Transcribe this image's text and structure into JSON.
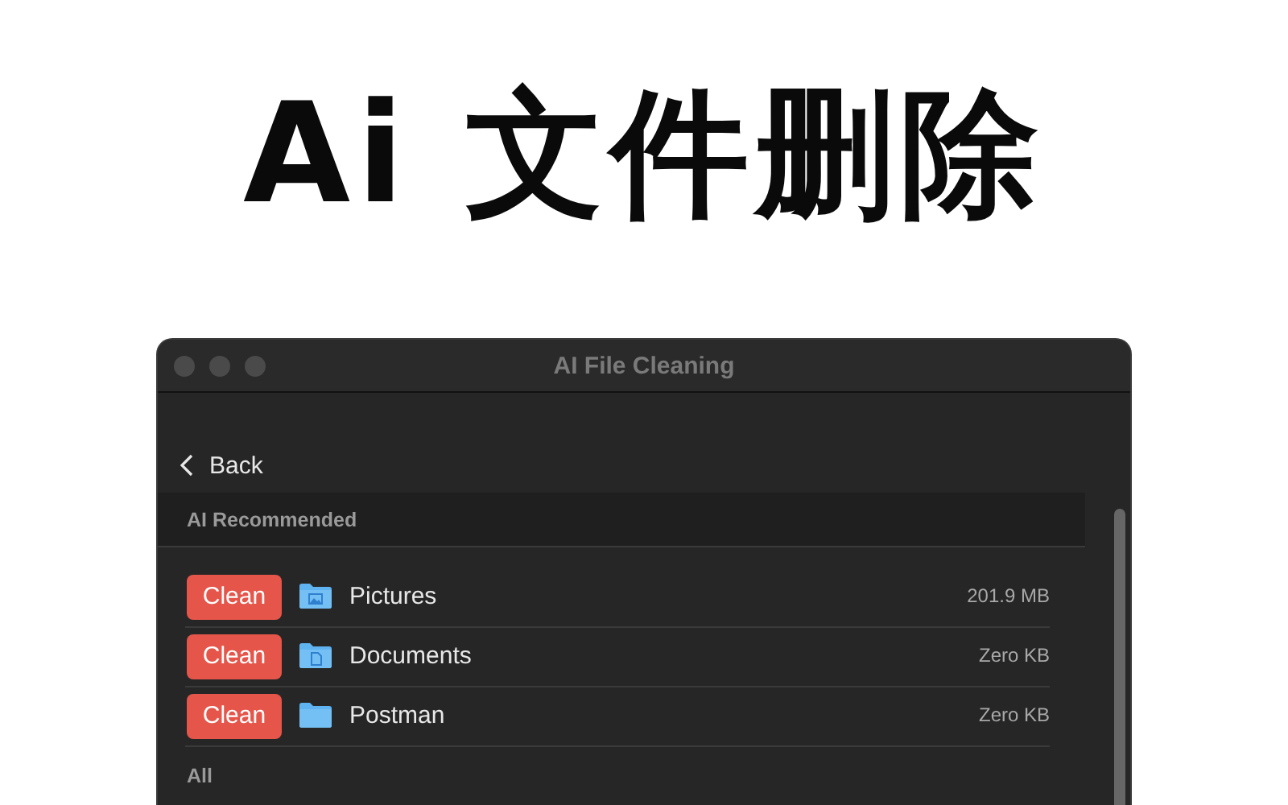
{
  "headline": "Ai 文件删除",
  "window": {
    "title": "AI File Cleaning"
  },
  "back": {
    "label": "Back"
  },
  "section": {
    "title": "AI Recommended"
  },
  "items": [
    {
      "action": "Clean",
      "kind": "pictures",
      "name": "Pictures",
      "size": "201.9 MB"
    },
    {
      "action": "Clean",
      "kind": "documents",
      "name": "Documents",
      "size": "Zero KB"
    },
    {
      "action": "Clean",
      "kind": "plain",
      "name": "Postman",
      "size": "Zero KB"
    }
  ],
  "next_section": {
    "title": "All"
  }
}
